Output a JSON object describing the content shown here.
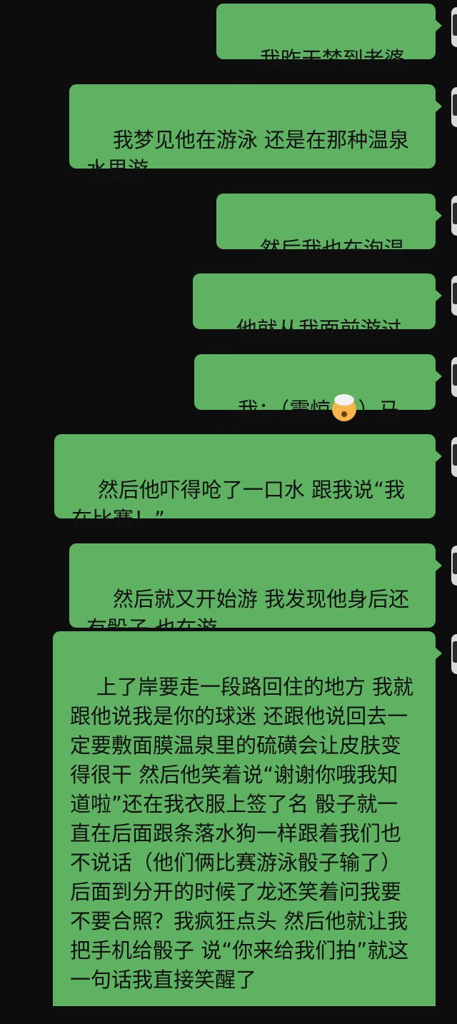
{
  "messages": [
    {
      "text": "我昨天梦到老婆了"
    },
    {
      "text": "我梦见他在游泳 还是在那种温泉水里游"
    },
    {
      "text": "然后我也在泡温泉"
    },
    {
      "text": "他就从我面前游过去"
    },
    {
      "prefix": "我：（震惊",
      "emoji": "exploding-head-emoji",
      "suffix": "）马龙？"
    },
    {
      "text": "然后他吓得呛了一口水 跟我说“我在比赛！”"
    },
    {
      "text": "然后就又开始游 我发现他身后还有骰子 也在游"
    },
    {
      "text": "上了岸要走一段路回住的地方 我就跟他说我是你的球迷 还跟他说回去一定要敷面膜温泉里的硫磺会让皮肤变得很干 然后他笑着说“谢谢你哦我知道啦”还在我衣服上签了名 骰子就一直在后面跟条落水狗一样跟着我们也不说话（他们俩比赛游泳骰子输了）后面到分开的时候了龙还笑着问我要不要合照？我疯狂点头 然后他就让我把手机给骰子 说“你来给我们拍”就这一句话我直接笑醒了"
    }
  ],
  "colors": {
    "bubble": "#5fb261",
    "background": "#0d0d0d",
    "text": "#111111"
  }
}
